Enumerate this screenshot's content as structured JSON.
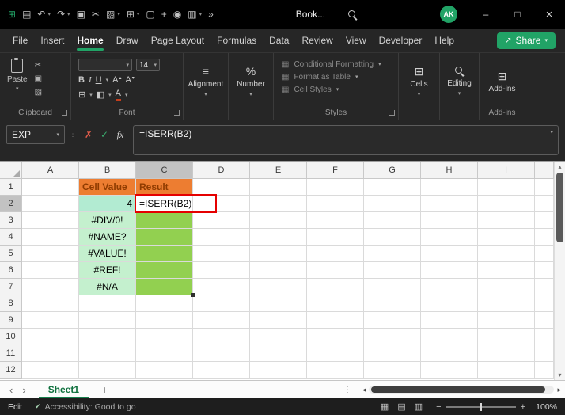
{
  "colors": {
    "accent_green": "#21A366",
    "edit_border_red": "#E50000",
    "orange_header": "#ED7D31",
    "light_green_fill": "#C4F0CE",
    "mint_fill": "#B2EBD2",
    "medium_green_fill": "#92D050"
  },
  "icons": {
    "chevron_down": "▾",
    "dots_v": "⋮",
    "cancel": "✗",
    "enter": "✓",
    "fx": "fx",
    "scissors": "✂",
    "copy": "▣",
    "painter": "▨",
    "bold": "B",
    "italic": "I",
    "underline": "U",
    "grow_letter": "A",
    "tri_up": "▴",
    "tri_down": "▾",
    "tri_left": "◂",
    "tri_right": "▸",
    "align_lines": "≡",
    "percent": "%",
    "style_swatch": "▦",
    "cells_grid": "⊞",
    "borders_grid": "⊞",
    "fill_swatch": "◧",
    "font_color_letter": "A",
    "addins_grid": "⊞",
    "nav_left": "‹",
    "nav_right": "›",
    "plus": "+",
    "view_normal": "▦",
    "view_layout": "▤",
    "view_break": "▥",
    "minus": "−",
    "close": "×",
    "maximize": "□",
    "minimize": "–",
    "check_badge": "✔",
    "share_arrow": "↗"
  },
  "titlebar": {
    "title": "Book...",
    "avatar": "AK",
    "icons": [
      {
        "name": "excel-app-icon",
        "glyph": "⊞",
        "color": "#21A366"
      },
      {
        "name": "save-icon",
        "glyph": "▤"
      },
      {
        "name": "undo-icon",
        "glyph": "↶"
      },
      {
        "name": "undo-chevron-icon",
        "glyph": "▾"
      },
      {
        "name": "redo-icon",
        "glyph": "↷"
      },
      {
        "name": "redo-chevron-icon",
        "glyph": "▾"
      },
      {
        "name": "copy-icon",
        "glyph": "▣"
      },
      {
        "name": "cut-icon",
        "glyph": "✂"
      },
      {
        "name": "format-painter-icon",
        "glyph": "▨"
      },
      {
        "name": "painter-chevron-icon",
        "glyph": "▾"
      },
      {
        "name": "table-icon",
        "glyph": "⊞"
      },
      {
        "name": "table-chevron-icon",
        "glyph": "▾"
      },
      {
        "name": "document-icon",
        "glyph": "▢"
      },
      {
        "name": "add-icon",
        "glyph": "+"
      },
      {
        "name": "camera-icon",
        "glyph": "◉"
      },
      {
        "name": "chart-icon",
        "glyph": "▥"
      },
      {
        "name": "chart-chevron-icon",
        "glyph": "▾"
      },
      {
        "name": "overflow-icon",
        "glyph": "»"
      }
    ]
  },
  "menu": {
    "tabs": [
      {
        "label": "File"
      },
      {
        "label": "Insert"
      },
      {
        "label": "Home",
        "active": true
      },
      {
        "label": "Draw"
      },
      {
        "label": "Page Layout"
      },
      {
        "label": "Formulas"
      },
      {
        "label": "Data"
      },
      {
        "label": "Review"
      },
      {
        "label": "View"
      },
      {
        "label": "Developer"
      },
      {
        "label": "Help"
      }
    ],
    "share_label": "Share"
  },
  "ribbon": {
    "clipboard": {
      "label": "Clipboard",
      "paste_label": "Paste"
    },
    "font": {
      "label": "Font",
      "size_value": "14"
    },
    "alignment": {
      "label": "Alignment"
    },
    "number": {
      "label": "Number"
    },
    "styles": {
      "label": "Styles",
      "items": [
        "Conditional Formatting",
        "Format as Table",
        "Cell Styles"
      ]
    },
    "cells": {
      "label": "Cells"
    },
    "editing": {
      "label": "Editing"
    },
    "addins": {
      "label": "Add-ins"
    }
  },
  "formula_bar": {
    "name_box": "EXP",
    "formula": "=ISERR(B2)"
  },
  "grid": {
    "columns": [
      "A",
      "B",
      "C",
      "D",
      "E",
      "F",
      "G",
      "H",
      "I"
    ],
    "rows": [
      1,
      2,
      3,
      4,
      5,
      6,
      7,
      8,
      9,
      10,
      11,
      12
    ],
    "selected_column": "C",
    "selected_row": 2,
    "active_cell": "C2",
    "cells": [
      {
        "addr": "B1",
        "text": "Cell Value",
        "bg": "#ED7D31",
        "color": "#8F3B00",
        "bold": true,
        "align": "left"
      },
      {
        "addr": "C1",
        "text": "Result",
        "bg": "#ED7D31",
        "color": "#8F3B00",
        "bold": true,
        "align": "left"
      },
      {
        "addr": "B2",
        "text": "4",
        "bg": "#B2EBD2",
        "align": "right"
      },
      {
        "addr": "C2",
        "text": "=ISERR(B2)",
        "bg": "#FFFFFF",
        "align": "left",
        "editing": true
      },
      {
        "addr": "B3",
        "text": "#DIV/0!",
        "bg": "#C4F0CE",
        "align": "center"
      },
      {
        "addr": "C3",
        "text": "",
        "bg": "#92D050"
      },
      {
        "addr": "B4",
        "text": "#NAME?",
        "bg": "#C4F0CE",
        "align": "center"
      },
      {
        "addr": "C4",
        "text": "",
        "bg": "#92D050"
      },
      {
        "addr": "B5",
        "text": "#VALUE!",
        "bg": "#C4F0CE",
        "align": "center"
      },
      {
        "addr": "C5",
        "text": "",
        "bg": "#92D050"
      },
      {
        "addr": "B6",
        "text": "#REF!",
        "bg": "#C4F0CE",
        "align": "center"
      },
      {
        "addr": "C6",
        "text": "",
        "bg": "#92D050"
      },
      {
        "addr": "B7",
        "text": "#N/A",
        "bg": "#C4F0CE",
        "align": "center"
      },
      {
        "addr": "C7",
        "text": "",
        "bg": "#92D050"
      }
    ]
  },
  "sheetbar": {
    "tab": "Sheet1"
  },
  "statusbar": {
    "mode": "Edit",
    "accessibility": "Accessibility: Good to go",
    "zoom": "100%"
  }
}
